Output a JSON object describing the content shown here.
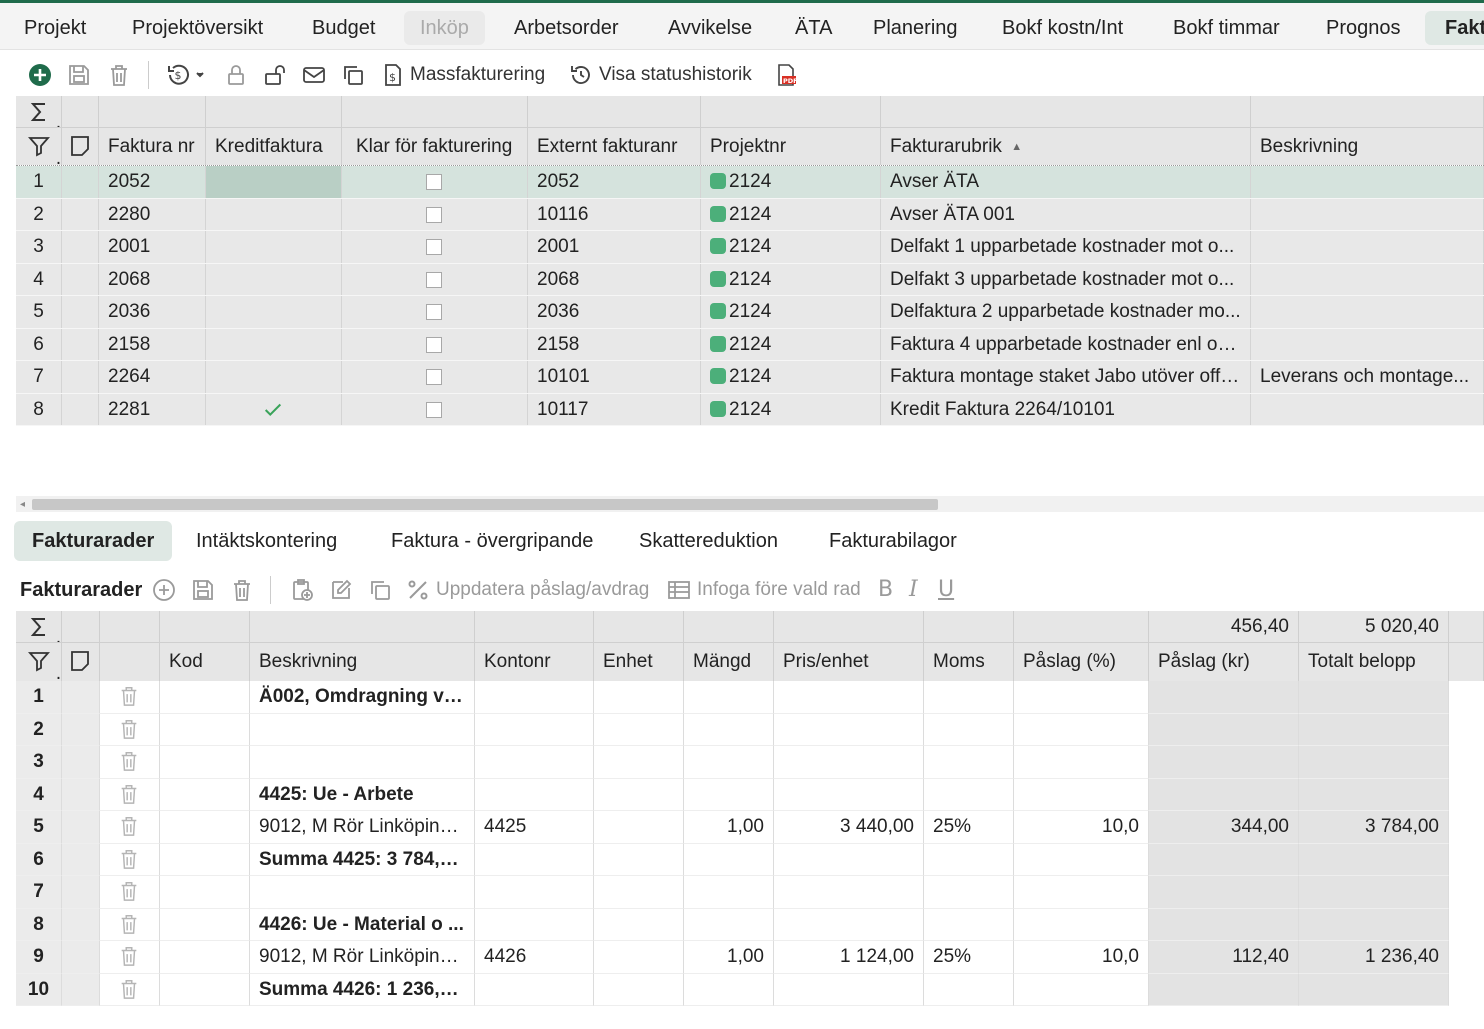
{
  "main_tabs": [
    {
      "label": "Projekt",
      "state": "normal"
    },
    {
      "label": "Projektöversikt",
      "state": "normal"
    },
    {
      "label": "Budget",
      "state": "normal"
    },
    {
      "label": "Inköp",
      "state": "disabled"
    },
    {
      "label": "Arbetsorder",
      "state": "normal"
    },
    {
      "label": "Avvikelse",
      "state": "normal"
    },
    {
      "label": "ÄTA",
      "state": "normal"
    },
    {
      "label": "Planering",
      "state": "normal"
    },
    {
      "label": "Bokf kostn/Int",
      "state": "normal"
    },
    {
      "label": "Bokf timmar",
      "state": "normal"
    },
    {
      "label": "Prognos",
      "state": "normal"
    },
    {
      "label": "Fakt",
      "state": "active"
    }
  ],
  "toolbar": {
    "mass_invoicing_label": "Massfakturering",
    "status_history_label": "Visa statushistorik",
    "icons": [
      "add-icon",
      "save-icon",
      "trash-icon",
      "history-icon",
      "lock-icon",
      "unlock-icon",
      "mail-icon",
      "copy-icon",
      "invoice-icon",
      "clock-history-icon",
      "pdf-icon"
    ]
  },
  "invoice_grid": {
    "columns": [
      "Faktura nr",
      "Kreditfaktura",
      "Klar för fakturering",
      "Externt fakturanr",
      "Projektnr",
      "Fakturarubrik",
      "Beskrivning"
    ],
    "rows": [
      {
        "num": "1",
        "faktura_nr": "2052",
        "kredit": false,
        "klar": false,
        "externt": "2052",
        "projekt": "2124",
        "rubrik": "Avser ÄTA",
        "beskrivning": ""
      },
      {
        "num": "2",
        "faktura_nr": "2280",
        "kredit": false,
        "klar": false,
        "externt": "10116",
        "projekt": "2124",
        "rubrik": "Avser ÄTA 001",
        "beskrivning": ""
      },
      {
        "num": "3",
        "faktura_nr": "2001",
        "kredit": false,
        "klar": false,
        "externt": "2001",
        "projekt": "2124",
        "rubrik": "Delfakt 1 upparbetade kostnader mot o...",
        "beskrivning": ""
      },
      {
        "num": "4",
        "faktura_nr": "2068",
        "kredit": false,
        "klar": false,
        "externt": "2068",
        "projekt": "2124",
        "rubrik": "Delfakt 3 upparbetade kostnader mot o...",
        "beskrivning": ""
      },
      {
        "num": "5",
        "faktura_nr": "2036",
        "kredit": false,
        "klar": false,
        "externt": "2036",
        "projekt": "2124",
        "rubrik": "Delfaktura 2 upparbetade kostnader mo...",
        "beskrivning": ""
      },
      {
        "num": "6",
        "faktura_nr": "2158",
        "kredit": false,
        "klar": false,
        "externt": "2158",
        "projekt": "2124",
        "rubrik": "Faktura 4 upparbetade kostnader enl off...",
        "beskrivning": ""
      },
      {
        "num": "7",
        "faktura_nr": "2264",
        "kredit": false,
        "klar": false,
        "externt": "10101",
        "projekt": "2124",
        "rubrik": "Faktura montage staket Jabo utöver offe...",
        "beskrivning": "Leverans och montage..."
      },
      {
        "num": "8",
        "faktura_nr": "2281",
        "kredit": true,
        "klar": false,
        "externt": "10117",
        "projekt": "2124",
        "rubrik": "Kredit Faktura 2264/10101",
        "beskrivning": ""
      }
    ]
  },
  "sub_tabs": [
    {
      "label": "Fakturarader",
      "active": true
    },
    {
      "label": "Intäktskontering",
      "active": false
    },
    {
      "label": "Faktura - övergripande",
      "active": false
    },
    {
      "label": "Skattereduktion",
      "active": false
    },
    {
      "label": "Fakturabilagor",
      "active": false
    }
  ],
  "rows_toolbar": {
    "title": "Fakturarader",
    "update_markup_label": "Uppdatera påslag/avdrag",
    "insert_before_label": "Infoga före vald rad",
    "format_bold": "B",
    "format_italic": "I",
    "format_underline": "U"
  },
  "rows_grid": {
    "sum_paslag_kr": "456,40",
    "sum_totalt": "5 020,40",
    "columns": [
      "Kod",
      "Beskrivning",
      "Kontonr",
      "Enhet",
      "Mängd",
      "Pris/enhet",
      "Moms",
      "Påslag (%)",
      "Påslag (kr)",
      "Totalt belopp"
    ],
    "rows": [
      {
        "num": "1",
        "kod": "",
        "beskrivning": "Ä002, Omdragning vär...",
        "bold": true,
        "kontonr": "",
        "enhet": "",
        "mangd": "",
        "pris": "",
        "moms": "",
        "paslag_pct": "",
        "paslag_kr": "",
        "totalt": ""
      },
      {
        "num": "2",
        "kod": "",
        "beskrivning": "",
        "bold": false,
        "kontonr": "",
        "enhet": "",
        "mangd": "",
        "pris": "",
        "moms": "",
        "paslag_pct": "",
        "paslag_kr": "",
        "totalt": ""
      },
      {
        "num": "3",
        "kod": "",
        "beskrivning": "",
        "bold": false,
        "kontonr": "",
        "enhet": "",
        "mangd": "",
        "pris": "",
        "moms": "",
        "paslag_pct": "",
        "paslag_kr": "",
        "totalt": ""
      },
      {
        "num": "4",
        "kod": "",
        "beskrivning": "4425: Ue - Arbete",
        "bold": true,
        "kontonr": "",
        "enhet": "",
        "mangd": "",
        "pris": "",
        "moms": "",
        "paslag_pct": "",
        "paslag_kr": "",
        "totalt": ""
      },
      {
        "num": "5",
        "kod": "",
        "beskrivning": "9012, M Rör Linköping ...",
        "bold": false,
        "kontonr": "4425",
        "enhet": "",
        "mangd": "1,00",
        "pris": "3 440,00",
        "moms": "25%",
        "paslag_pct": "10,0",
        "paslag_kr": "344,00",
        "totalt": "3 784,00"
      },
      {
        "num": "6",
        "kod": "",
        "beskrivning": "Summa 4425: 3 784,0...",
        "bold": true,
        "kontonr": "",
        "enhet": "",
        "mangd": "",
        "pris": "",
        "moms": "",
        "paslag_pct": "",
        "paslag_kr": "",
        "totalt": ""
      },
      {
        "num": "7",
        "kod": "",
        "beskrivning": "",
        "bold": false,
        "kontonr": "",
        "enhet": "",
        "mangd": "",
        "pris": "",
        "moms": "",
        "paslag_pct": "",
        "paslag_kr": "",
        "totalt": ""
      },
      {
        "num": "8",
        "kod": "",
        "beskrivning": "4426: Ue - Material o ...",
        "bold": true,
        "kontonr": "",
        "enhet": "",
        "mangd": "",
        "pris": "",
        "moms": "",
        "paslag_pct": "",
        "paslag_kr": "",
        "totalt": ""
      },
      {
        "num": "9",
        "kod": "",
        "beskrivning": "9012, M Rör Linköping ...",
        "bold": false,
        "kontonr": "4426",
        "enhet": "",
        "mangd": "1,00",
        "pris": "1 124,00",
        "moms": "25%",
        "paslag_pct": "10,0",
        "paslag_kr": "112,40",
        "totalt": "1 236,40"
      },
      {
        "num": "10",
        "kod": "",
        "beskrivning": "Summa 4426: 1 236,4...",
        "bold": true,
        "kontonr": "",
        "enhet": "",
        "mangd": "",
        "pris": "",
        "moms": "",
        "paslag_pct": "",
        "paslag_kr": "",
        "totalt": ""
      }
    ]
  },
  "colors": {
    "accent": "#1f6b4b",
    "selected_row": "#d5e3dd",
    "project_dot": "#4caf7a",
    "check": "#3aa35a"
  }
}
